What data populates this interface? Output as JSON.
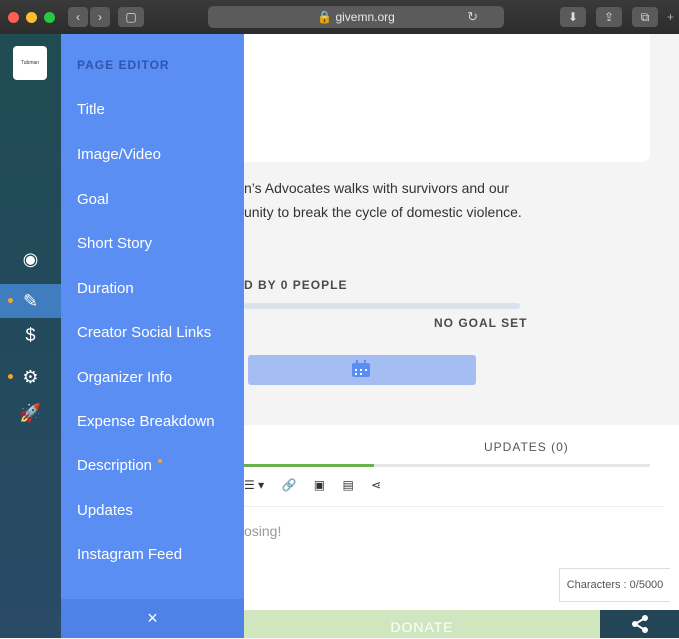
{
  "browser": {
    "url": "givemn.org"
  },
  "logo_text": "Tubman",
  "panel": {
    "heading": "PAGE EDITOR",
    "items": [
      {
        "label": "Title"
      },
      {
        "label": "Image/Video"
      },
      {
        "label": "Goal"
      },
      {
        "label": "Short Story"
      },
      {
        "label": "Duration"
      },
      {
        "label": "Creator Social Links"
      },
      {
        "label": "Organizer Info"
      },
      {
        "label": "Expense Breakdown"
      },
      {
        "label": "Description",
        "has_indicator": true
      },
      {
        "label": "Updates"
      },
      {
        "label": "Instagram Feed"
      }
    ],
    "close": "×"
  },
  "rail": {
    "icons": [
      "eye-icon",
      "pencil-icon",
      "dollar-icon",
      "gears-icon",
      "rocket-icon"
    ],
    "active": "pencil-icon"
  },
  "main": {
    "story_line1": "n’s Advocates walks with survivors and our",
    "story_line2": "unity to break the cycle of domestic violence.",
    "raised_text": "D BY 0 PEOPLE",
    "goal_text": "NO GOAL SET",
    "tab_updates": "UPDATES (0)",
    "editor_placeholder": "osing!",
    "characters": "Characters : 0/5000",
    "donate": "DONATE"
  },
  "colors": {
    "panel": "#5b8ef2",
    "rail": "#234a5c",
    "accent_orange": "#f5a623",
    "tab_active": "#6ab04c"
  }
}
